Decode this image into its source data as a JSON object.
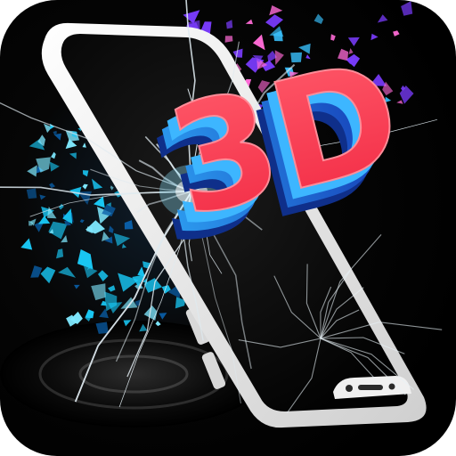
{
  "app_icon": {
    "logo_text": "3D",
    "icon_name": "3d-wallpaper-app-icon"
  },
  "palette": {
    "background": "#050505",
    "phone_frame": "#f2f2f2",
    "screen": "#070707",
    "shard_blue": "#19c8f5",
    "shard_pink": "#ff6bd6",
    "logo_face": "#ff3b4f",
    "logo_side": "#1e5fd6"
  }
}
